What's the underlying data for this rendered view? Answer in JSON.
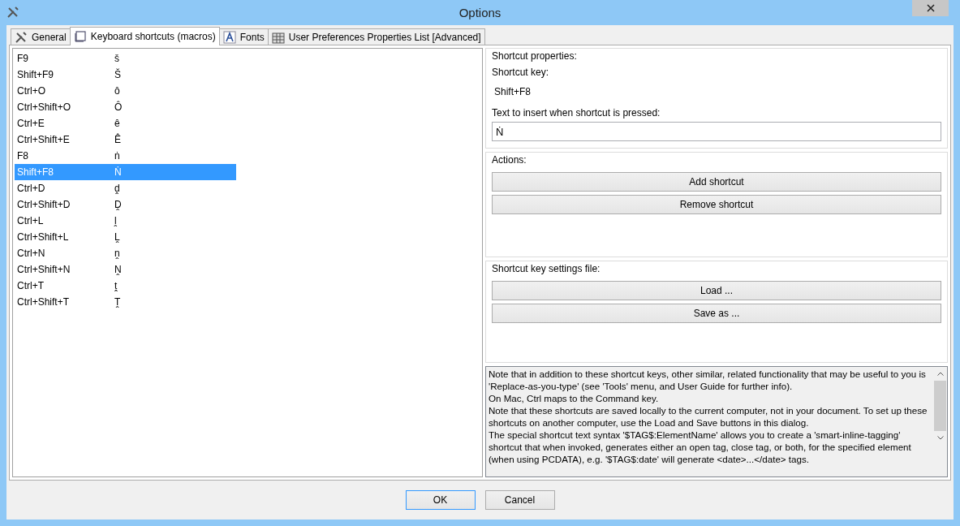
{
  "window": {
    "title": "Options"
  },
  "tabs": [
    {
      "label": "General",
      "selected": false
    },
    {
      "label": "Keyboard shortcuts (macros)",
      "selected": true
    },
    {
      "label": "Fonts",
      "selected": false
    },
    {
      "label": "User Preferences Properties List [Advanced]",
      "selected": false
    }
  ],
  "shortcuts": [
    {
      "key": "F9",
      "text": "š",
      "selected": false
    },
    {
      "key": "Shift+F9",
      "text": "Š",
      "selected": false
    },
    {
      "key": "Ctrl+O",
      "text": "ô",
      "selected": false
    },
    {
      "key": "Ctrl+Shift+O",
      "text": "Ô",
      "selected": false
    },
    {
      "key": "Ctrl+E",
      "text": "ê",
      "selected": false
    },
    {
      "key": "Ctrl+Shift+E",
      "text": "Ê",
      "selected": false
    },
    {
      "key": "F8",
      "text": "ṅ",
      "selected": false
    },
    {
      "key": "Shift+F8",
      "text": "Ṅ",
      "selected": true
    },
    {
      "key": "Ctrl+D",
      "text": "ḓ",
      "selected": false
    },
    {
      "key": "Ctrl+Shift+D",
      "text": "Ḓ",
      "selected": false
    },
    {
      "key": "Ctrl+L",
      "text": "ḽ",
      "selected": false
    },
    {
      "key": "Ctrl+Shift+L",
      "text": "Ḽ",
      "selected": false
    },
    {
      "key": "Ctrl+N",
      "text": "ṋ",
      "selected": false
    },
    {
      "key": "Ctrl+Shift+N",
      "text": "Ṋ",
      "selected": false
    },
    {
      "key": "Ctrl+T",
      "text": "ṱ",
      "selected": false
    },
    {
      "key": "Ctrl+Shift+T",
      "text": "Ṱ",
      "selected": false
    }
  ],
  "properties": {
    "legend": "Shortcut properties:",
    "key_label": "Shortcut key:",
    "key_value": "Shift+F8",
    "text_label": "Text to insert when shortcut is pressed:",
    "text_value": "Ṅ"
  },
  "actions": {
    "legend": "Actions:",
    "buttons": [
      "Add shortcut",
      "Remove shortcut"
    ]
  },
  "settings_file": {
    "legend": "Shortcut key settings file:",
    "buttons": [
      "Load ...",
      "Save as ..."
    ]
  },
  "notes": [
    "Note that in addition to these shortcut keys, other similar, related functionality that may be useful to you is 'Replace-as-you-type' (see 'Tools' menu, and User Guide for further info).",
    "On Mac, Ctrl maps to the Command key.",
    "Note that these shortcuts are saved locally to the current computer, not in your document. To set up these shortcuts on another computer, use the Load and Save buttons in this dialog.",
    "The special shortcut text syntax '$TAG$:ElementName' allows you to create a 'smart-inline-tagging' shortcut that when invoked, generates either an open tag, close tag, or both, for the specified element (when using PCDATA), e.g. '$TAG$:date' will generate <date>...</date> tags."
  ],
  "footer": {
    "buttons": [
      {
        "label": "OK",
        "selected": true
      },
      {
        "label": "Cancel",
        "selected": false
      }
    ]
  }
}
